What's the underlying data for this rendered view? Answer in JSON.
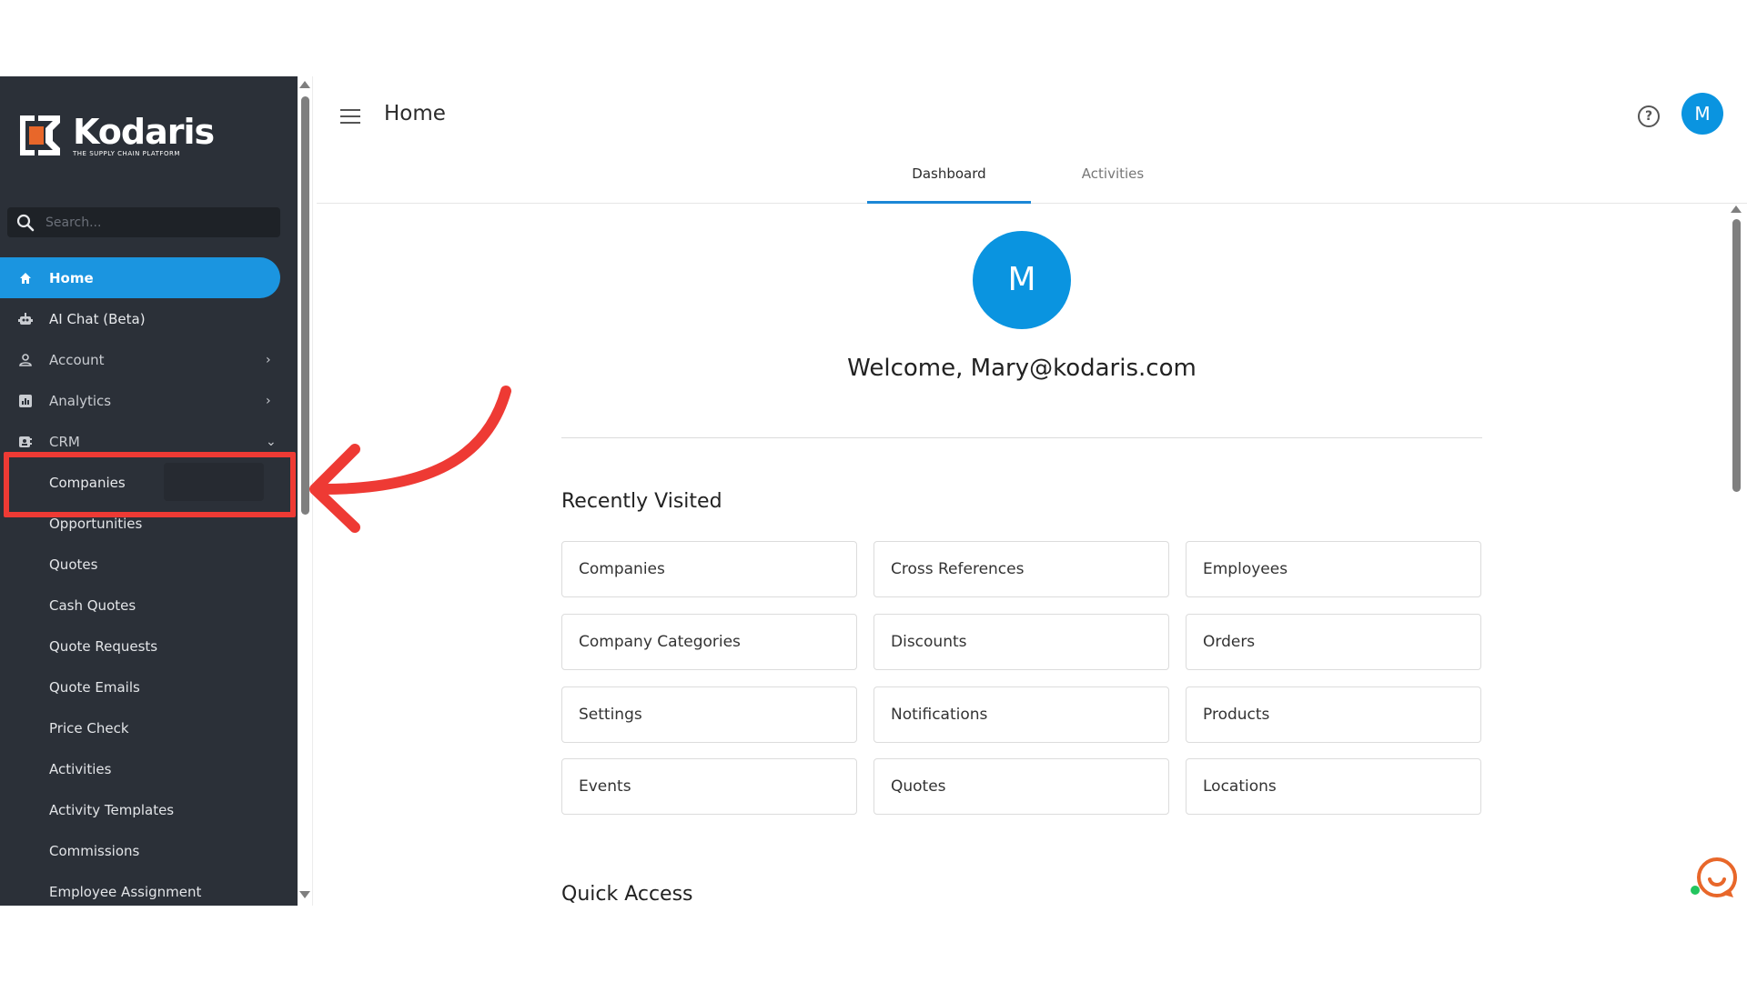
{
  "brand": {
    "name": "Kodaris",
    "tagline": "THE SUPPLY CHAIN PLATFORM",
    "accent": "#1b95e0",
    "logo_orange": "#e8672a",
    "sidebar_bg": "#2b3038",
    "highlight": "#ee3a34"
  },
  "sidebar": {
    "search_placeholder": "Search...",
    "items": [
      {
        "label": "Home",
        "icon": "home-icon",
        "active": true
      },
      {
        "label": "AI Chat (Beta)",
        "icon": "robot-icon"
      },
      {
        "label": "Account",
        "icon": "person-icon",
        "chevron": "›"
      },
      {
        "label": "Analytics",
        "icon": "chart-icon",
        "chevron": "›"
      },
      {
        "label": "CRM",
        "icon": "crm-icon",
        "chevron": "⌄"
      },
      {
        "label": "Companies"
      },
      {
        "label": "Opportunities"
      },
      {
        "label": "Quotes"
      },
      {
        "label": "Cash Quotes"
      },
      {
        "label": "Quote Requests"
      },
      {
        "label": "Quote Emails"
      },
      {
        "label": "Price Check"
      },
      {
        "label": "Activities"
      },
      {
        "label": "Activity Templates"
      },
      {
        "label": "Commissions"
      },
      {
        "label": "Employee Assignment"
      }
    ]
  },
  "header": {
    "title": "Home",
    "help_glyph": "?",
    "avatar_initial": "M"
  },
  "tabs": [
    {
      "label": "Dashboard",
      "active": true
    },
    {
      "label": "Activities"
    }
  ],
  "main": {
    "avatar_initial": "M",
    "welcome": "Welcome, Mary@kodaris.com",
    "recently_visited_title": "Recently Visited",
    "recently_visited": [
      "Companies",
      "Cross References",
      "Employees",
      "Company Categories",
      "Discounts",
      "Orders",
      "Settings",
      "Notifications",
      "Products",
      "Events",
      "Quotes",
      "Locations"
    ],
    "quick_access_title": "Quick Access"
  }
}
